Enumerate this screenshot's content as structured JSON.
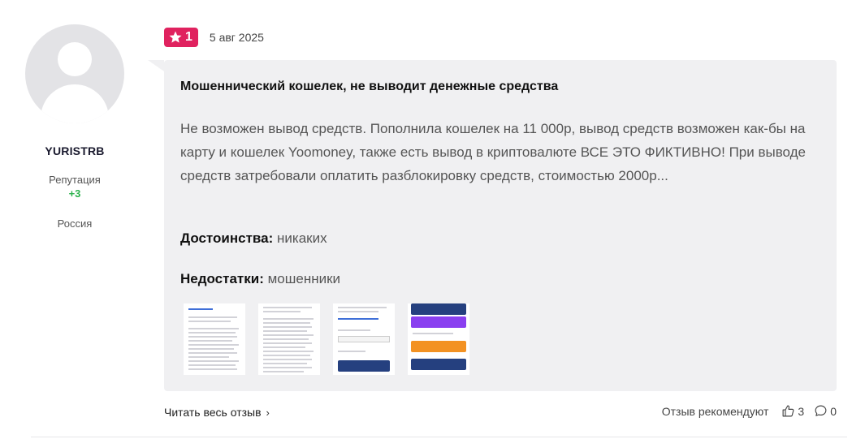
{
  "author": {
    "name": "YURISTRB",
    "reputation_label": "Репутация",
    "reputation_value": "+3",
    "country": "Россия"
  },
  "review": {
    "rating": "1",
    "date": "5 авг 2025",
    "title": "Мошеннический кошелек, не выводит денежные средства",
    "text": "Не возможен вывод средств. Пополнила кошелек на 11 000р, вывод средств возможен как-бы на карту и кошелек Yoomoney, также есть вывод в криптовалюте ВСЕ ЭТО ФИКТИВНО! При выводе средств затребовали оплатить разблокировку средств, стоимостью 2000р...",
    "pros_label": "Достоинства:",
    "pros_value": "никаких",
    "cons_label": "Недостатки:",
    "cons_value": "мошенники"
  },
  "footer": {
    "read_full": "Читать весь отзыв",
    "recommend_label": "Отзыв рекомендуют",
    "likes": "3",
    "comments": "0"
  },
  "colors": {
    "rating_badge": "#e0225f",
    "reputation": "#2bb24c",
    "bubble_bg": "#f0f0f2"
  }
}
